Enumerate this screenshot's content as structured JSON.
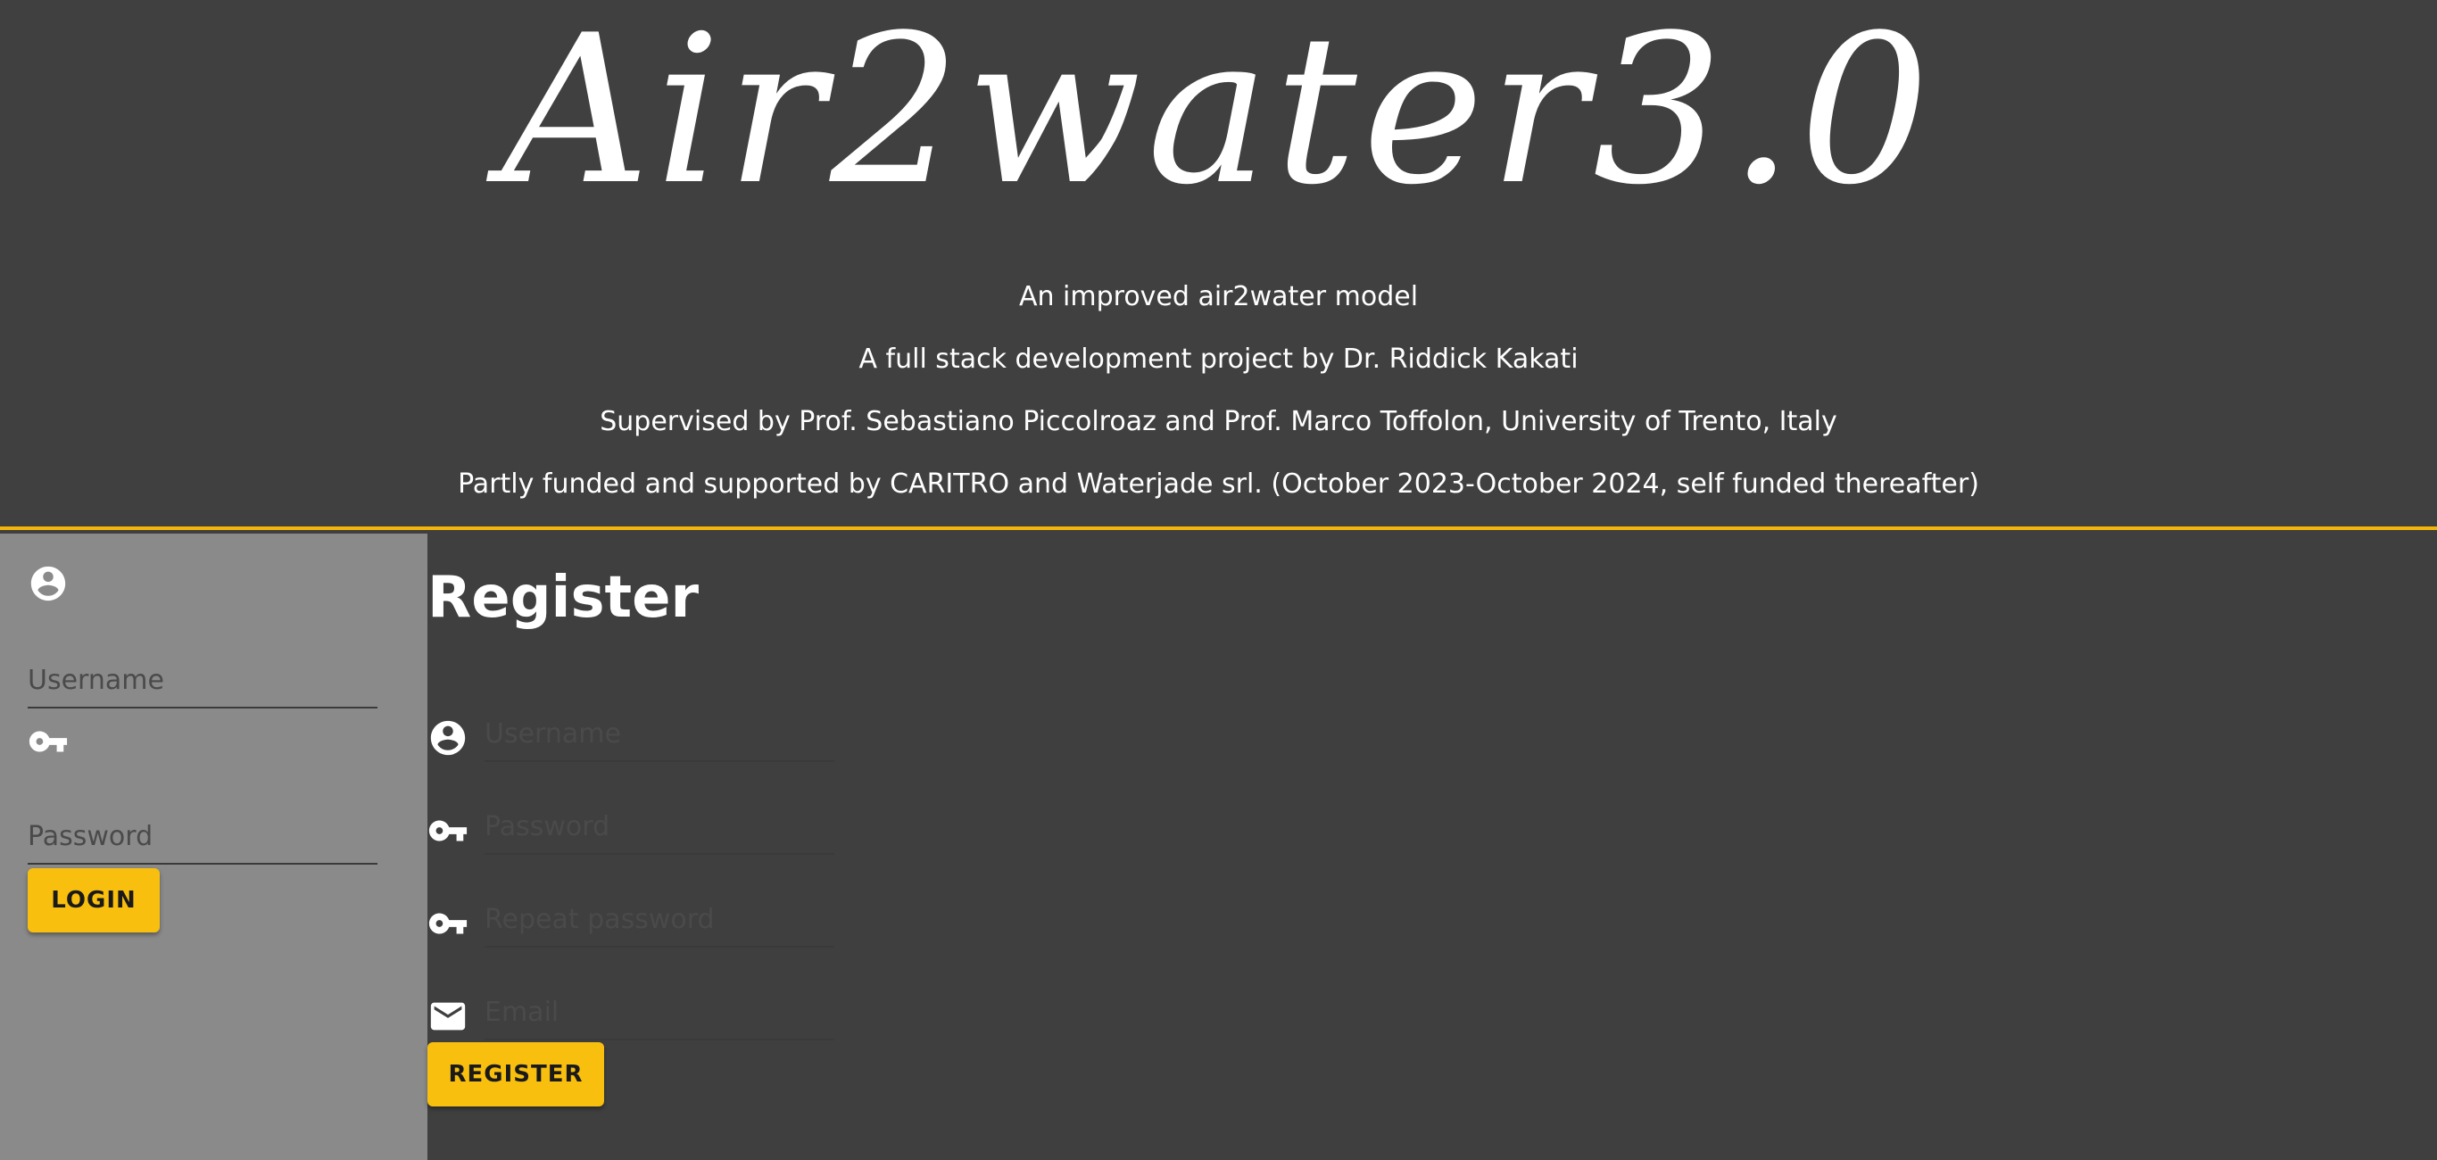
{
  "header": {
    "logo_text": "Air2water3.0",
    "lines": [
      "An improved air2water model",
      "A full stack development project by Dr. Riddick Kakati",
      "Supervised by Prof. Sebastiano Piccolroaz and Prof. Marco Toffolon, University of Trento, Italy",
      "Partly funded and supported by CARITRO and Waterjade srl. (October 2023-October 2024, self funded thereafter)"
    ]
  },
  "sidebar": {
    "username_placeholder": "Username",
    "password_placeholder": "Password",
    "login_label": "LOGIN"
  },
  "register": {
    "title": "Register",
    "username_placeholder": "Username",
    "password_placeholder": "Password",
    "repeat_password_placeholder": "Repeat password",
    "email_placeholder": "Email",
    "register_label": "REGISTER"
  },
  "icons": {
    "account": "account-circle-icon",
    "key": "key-icon",
    "email": "email-icon"
  },
  "colors": {
    "header_bg": "#404040",
    "accent": "#f8bf0e",
    "sidebar_bg": "#8a8a8a",
    "main_bg": "#3f3f3f"
  }
}
